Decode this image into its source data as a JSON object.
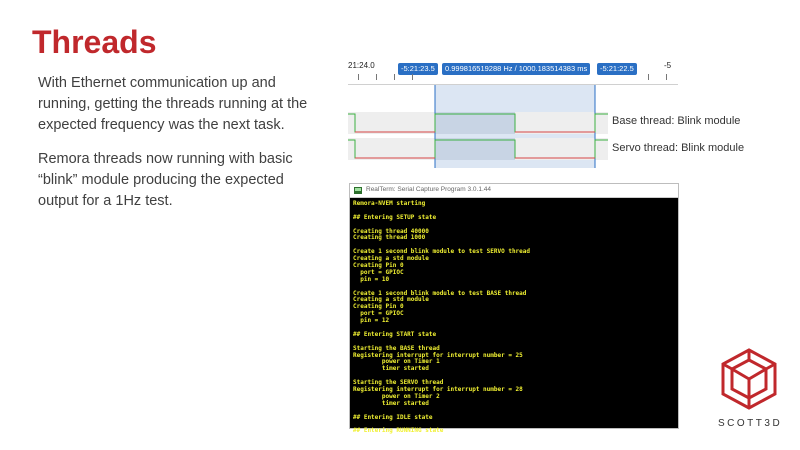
{
  "slide": {
    "title": "Threads",
    "paragraph1": "With Ethernet communication up and running, getting the threads running at the expected frequency was the next task.",
    "paragraph2": "Remora threads now running with basic “blink” module producing the expected output for a 1Hz test."
  },
  "analyzer": {
    "time_left": "21:24.0",
    "marker_left": "-5:21:23.5",
    "marker_mid": "0.999816519288 Hz / 1000.183514383 ms",
    "marker_right": "-5:21:22.5",
    "time_right": "-5",
    "tracks": [
      {
        "label": "Base thread: Blink module",
        "color": "#3cb043",
        "low_color": "#d64545"
      },
      {
        "label": "Servo thread: Blink module",
        "color": "#3cb043",
        "low_color": "#d64545"
      }
    ],
    "accent": "#2a6fc4"
  },
  "terminal": {
    "title": "RealTerm: Serial Capture Program 3.0.1.44",
    "lines": [
      "Remora-NVEM starting",
      "",
      "## Entering SETUP state",
      "",
      "Creating thread 40000",
      "Creating thread 1000",
      "",
      "Create 1 second blink module to test SERVO thread",
      "Creating a std module",
      "Creating Pin 0",
      "  port = GPIOC",
      "  pin = 10",
      "",
      "Create 1 second blink module to test BASE thread",
      "Creating a std module",
      "Creating Pin 0",
      "  port = GPIOC",
      "  pin = 12",
      "",
      "## Entering START state",
      "",
      "Starting the BASE thread",
      "Registering interrupt for interrupt number = 25",
      "        power on Timer 1",
      "        timer started",
      "",
      "Starting the SERVO thread",
      "Registering interrupt for interrupt number = 28",
      "        power on Timer 2",
      "        timer started",
      "",
      "## Entering IDLE state",
      "",
      "## Entering RUNNING state"
    ]
  },
  "logo": {
    "text": "SCOTT3D",
    "color": "#c0282c"
  }
}
